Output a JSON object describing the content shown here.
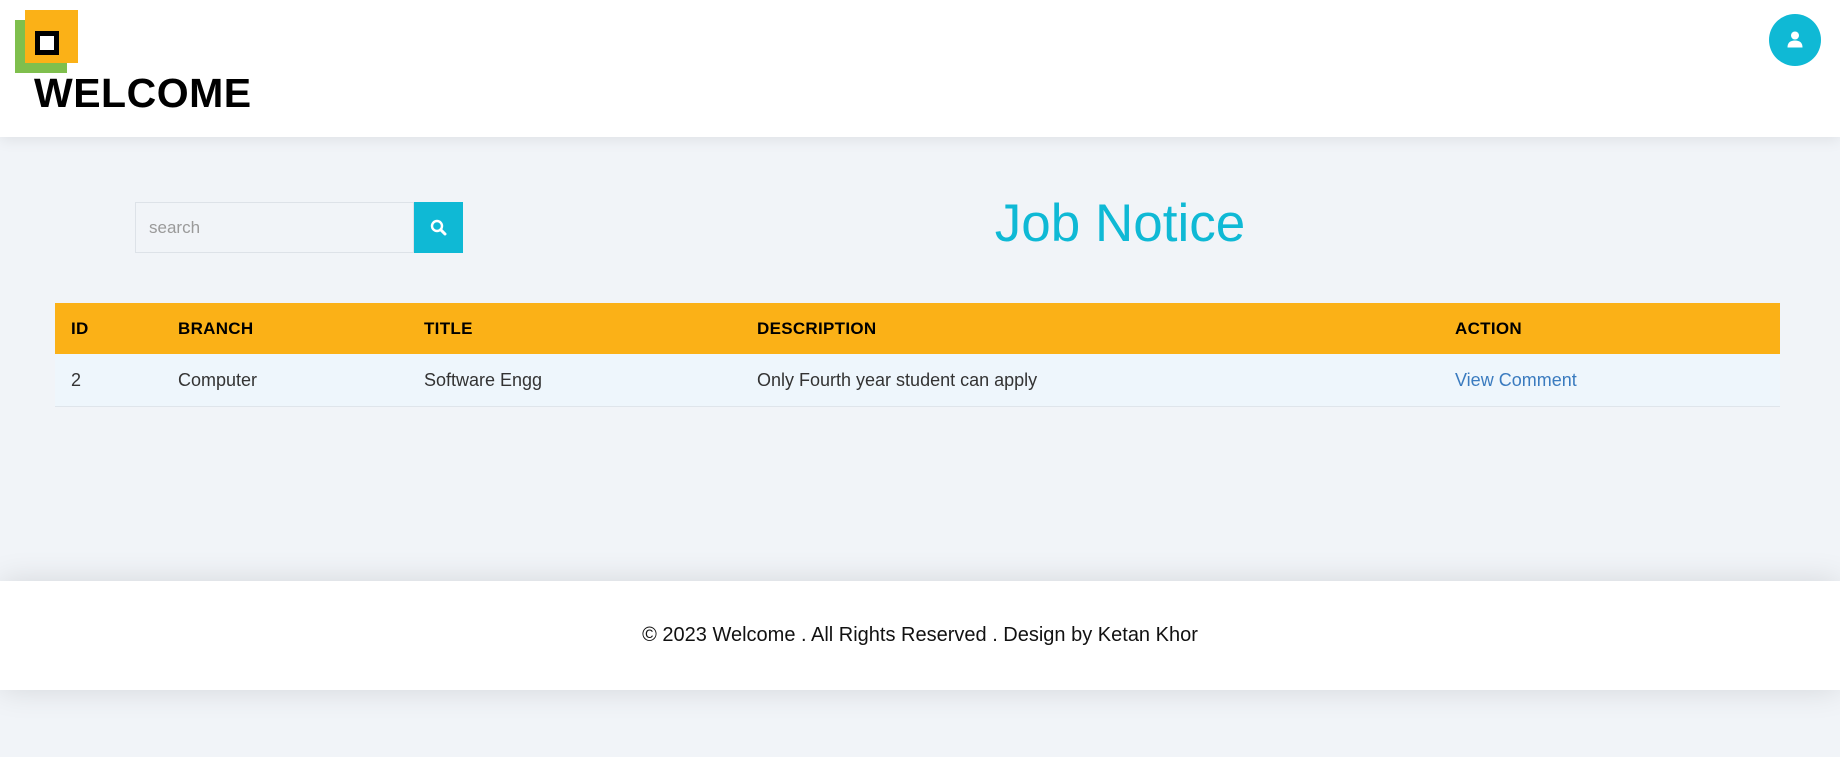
{
  "header": {
    "brand": "WELCOME"
  },
  "search": {
    "placeholder": "search"
  },
  "page": {
    "title": "Job Notice"
  },
  "table": {
    "columns": [
      "ID",
      "BRANCH",
      "TITLE",
      "DESCRIPTION",
      "ACTION"
    ],
    "rows": [
      {
        "id": "2",
        "branch": "Computer",
        "title": "Software Engg",
        "description": "Only Fourth year student can apply",
        "action": "View Comment"
      }
    ]
  },
  "footer": {
    "text": "© 2023 Welcome . All Rights Reserved . Design by Ketan Khor"
  },
  "colors": {
    "accent": "#0fb9d5",
    "header_row": "#fbb117",
    "logo_green": "#7fbf4d",
    "link": "#3a7bbf"
  },
  "icons": {
    "user": "user-icon",
    "search": "search-icon",
    "logo": "logo-icon"
  }
}
